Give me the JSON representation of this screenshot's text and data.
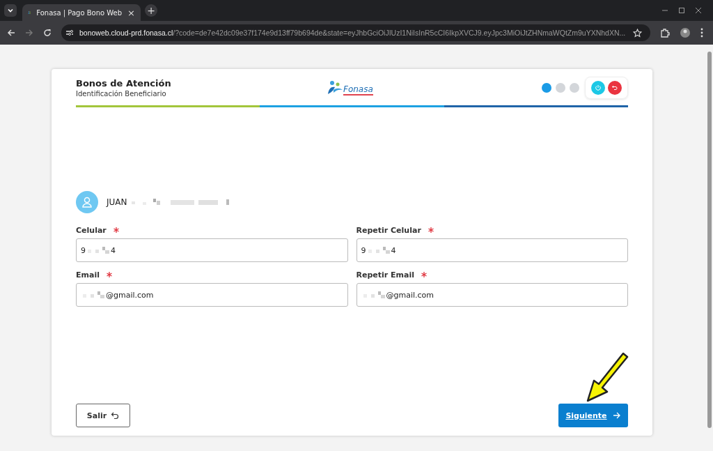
{
  "browser": {
    "tab_title": "Fonasa | Pago Bono Web",
    "new_tab": "+",
    "close_tab": "×",
    "url_host": "bonoweb.cloud-prd.fonasa.cl",
    "url_rest": "/?code=de7e42dc09e37f174e9d13ff79b694de&state=eyJhbGciOiJIUzI1NiIsInR5cCI6IkpXVCJ9.eyJpc3MiOiJtZHNmaWQtZm9uYXNhdXN..."
  },
  "header": {
    "title": "Bonos de Atención",
    "subtitle": "Identificación Beneficiario",
    "logo_text": "Fonasa"
  },
  "steps": [
    {
      "selected": true
    },
    {
      "selected": false
    },
    {
      "selected": false
    }
  ],
  "beneficiary": {
    "name": "JUAN"
  },
  "fields": [
    {
      "label": "Celular",
      "required": true,
      "value_start": "9",
      "value_end": "4"
    },
    {
      "label": "Repetir Celular",
      "required": true,
      "value_start": "9",
      "value_end": "4"
    },
    {
      "label": "Email",
      "required": true,
      "value_end": "@gmail.com"
    },
    {
      "label": "Repetir Email",
      "required": true,
      "value_end": "@gmail.com"
    }
  ],
  "buttons": {
    "exit": "Salir",
    "next": "Siguiente"
  }
}
